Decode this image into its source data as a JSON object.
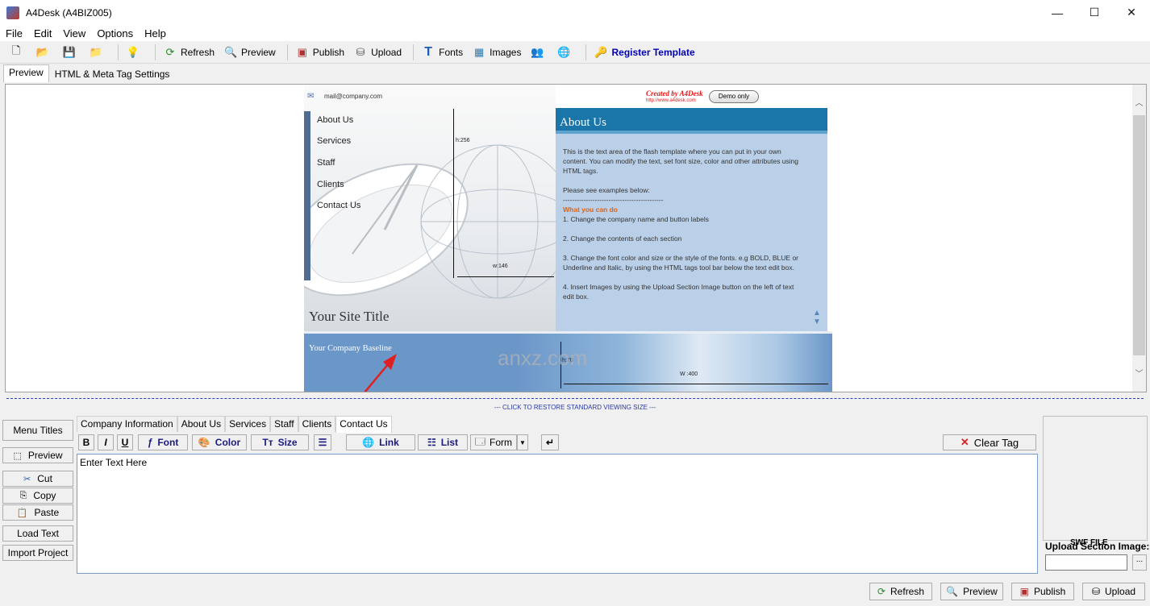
{
  "window": {
    "title": "A4Desk (A4BIZ005)",
    "minimize": "—",
    "maximize": "☐",
    "close": "✕"
  },
  "menu": [
    "File",
    "Edit",
    "View",
    "Options",
    "Help"
  ],
  "toolbar": {
    "refresh": "Refresh",
    "preview": "Preview",
    "publish": "Publish",
    "upload": "Upload",
    "fonts": "Fonts",
    "images": "Images",
    "register": "Register Template"
  },
  "tabs": {
    "preview": "Preview",
    "html_meta": "HTML & Meta Tag Settings"
  },
  "template": {
    "email": "mail@company.com",
    "nav": [
      "About Us",
      "Services",
      "Staff",
      "Clients",
      "Contact Us"
    ],
    "site_title": "Your Site Title",
    "credit": "Created by A4Desk",
    "credit_url": "http://www.a4desk.com",
    "demo_button": "Demo only",
    "about_title": "About Us",
    "about_p1": "This is the text area of the flash template where you can put in your own content.  You can modify the text, set font size, color and other attributes using HTML tags.",
    "about_p2": "Please see examples below:",
    "about_rule": "--------------------------------------------",
    "about_what": "What you can do",
    "about_i1": "1. Change the company name and button labels",
    "about_i2": "2. Change the contents of each section",
    "about_i3": "3. Change the font color and size or the style of the fonts. e.g BOLD, BLUE  or Underline and Italic, by using the HTML tags tool bar below the text edit box.",
    "about_i4": "4. Insert Images by using the Upload Section Image button on the left of text edit box.",
    "baseline": "Your Company Baseline",
    "dim_h256": "h:256",
    "dim_w146": "w:146",
    "dim_h70": "h:70",
    "dim_w400": "W :400",
    "watermark": "anxz.com"
  },
  "restore_bar": "--- CLICK TO RESTORE STANDARD VIEWING SIZE ---",
  "sidebar": {
    "menu_titles": "Menu Titles",
    "preview": "Preview",
    "cut": "Cut",
    "copy": "Copy",
    "paste": "Paste",
    "load_text": "Load Text",
    "import_project": "Import Project"
  },
  "subtabs": [
    "Company Information",
    "About Us",
    "Services",
    "Staff",
    "Clients",
    "Contact Us"
  ],
  "format": {
    "bold": "B",
    "italic": "I",
    "underline": "U",
    "font": "Font",
    "color": "Color",
    "size": "Size",
    "link": "Link",
    "list": "List",
    "form": "Form",
    "clear_tag": "Clear Tag"
  },
  "editor": {
    "text": "Enter Text Here"
  },
  "right": {
    "swf": "SWF FILE",
    "upload_label": "Upload Section Image:",
    "browse": "..."
  },
  "bottom": {
    "refresh": "Refresh",
    "preview": "Preview",
    "publish": "Publish",
    "upload": "Upload"
  }
}
